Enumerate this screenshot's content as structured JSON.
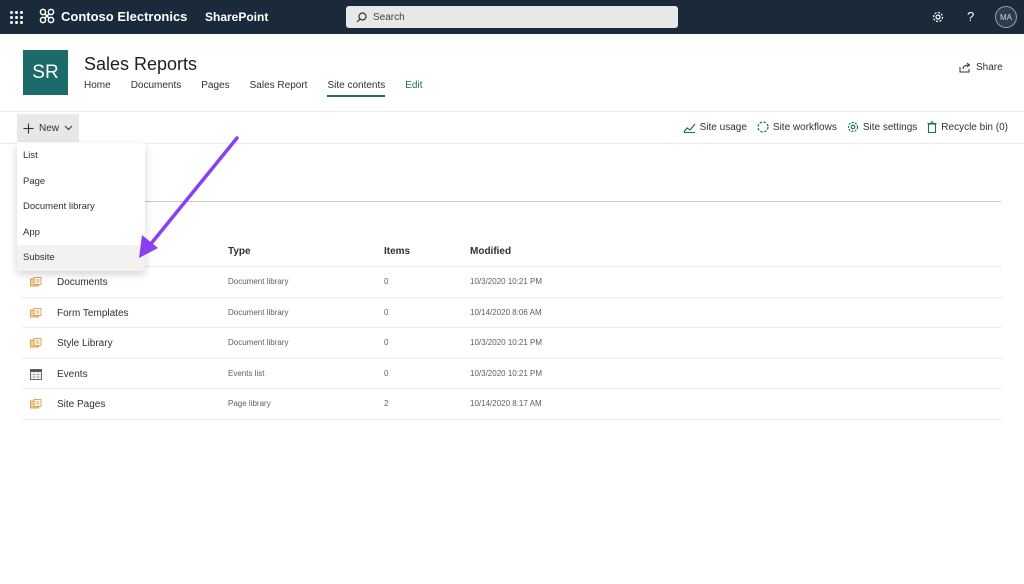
{
  "suite": {
    "brand": "Contoso Electronics",
    "app": "SharePoint",
    "search_placeholder": "Search",
    "avatar_initials": "MA"
  },
  "site": {
    "logo_text": "SR",
    "title": "Sales Reports",
    "nav": [
      "Home",
      "Documents",
      "Pages",
      "Sales Report",
      "Site contents",
      "Edit"
    ],
    "active_nav": "Site contents",
    "share_label": "Share"
  },
  "commandbar": {
    "new_label": "New",
    "site_usage": "Site usage",
    "site_workflows": "Site workflows",
    "site_settings": "Site settings",
    "recycle_bin": "Recycle bin (0)"
  },
  "new_menu": {
    "items": [
      "List",
      "Page",
      "Document library",
      "App",
      "Subsite"
    ],
    "highlighted": "Subsite"
  },
  "table": {
    "columns": {
      "type": "Type",
      "items": "Items",
      "modified": "Modified"
    },
    "rows": [
      {
        "name": "Documents",
        "type": "Document library",
        "items": "0",
        "modified": "10/3/2020 10:21 PM",
        "icon": "library-icon"
      },
      {
        "name": "Form Templates",
        "type": "Document library",
        "items": "0",
        "modified": "10/14/2020 8:06 AM",
        "icon": "library-icon"
      },
      {
        "name": "Style Library",
        "type": "Document library",
        "items": "0",
        "modified": "10/3/2020 10:21 PM",
        "icon": "library-icon"
      },
      {
        "name": "Events",
        "type": "Events list",
        "items": "0",
        "modified": "10/3/2020 10:21 PM",
        "icon": "calendar-icon"
      },
      {
        "name": "Site Pages",
        "type": "Page library",
        "items": "2",
        "modified": "10/14/2020 8:17 AM",
        "icon": "library-icon"
      }
    ]
  },
  "colors": {
    "suitebar": "#1b2a3a",
    "accent": "#1d6a6a",
    "annotation_arrow": "#8a3ff0"
  }
}
